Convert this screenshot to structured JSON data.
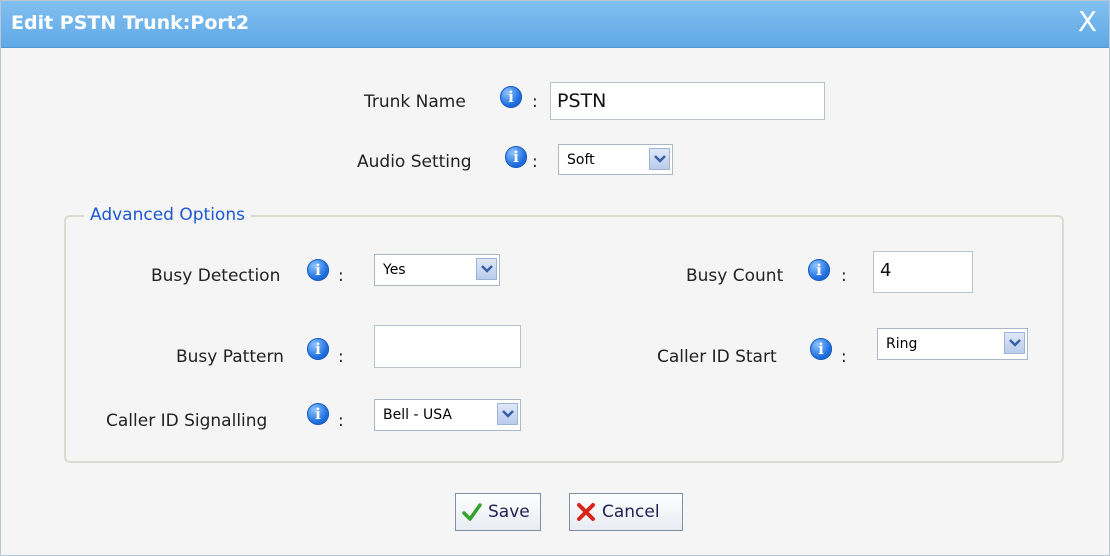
{
  "dialog": {
    "title": "Edit PSTN Trunk:Port2",
    "close_glyph": "X"
  },
  "fields": {
    "trunk_name": {
      "label": "Trunk Name",
      "value": "PSTN"
    },
    "audio_setting": {
      "label": "Audio Setting",
      "value": "Soft"
    }
  },
  "advanced": {
    "legend": "Advanced Options",
    "busy_detection": {
      "label": "Busy Detection",
      "value": "Yes"
    },
    "busy_count": {
      "label": "Busy Count",
      "value": "4"
    },
    "busy_pattern": {
      "label": "Busy Pattern",
      "value": ""
    },
    "caller_id_start": {
      "label": "Caller ID Start",
      "value": "Ring"
    },
    "caller_id_signalling": {
      "label": "Caller ID Signalling",
      "value": "Bell - USA"
    }
  },
  "buttons": {
    "save": "Save",
    "cancel": "Cancel"
  },
  "colors": {
    "titlebar": "#6fb4ec",
    "legend": "#1c58cf",
    "info_icon": "#1f6fe0"
  },
  "icons": [
    "info-icon",
    "close-icon",
    "checkmark-icon",
    "cross-icon",
    "dropdown-arrow-icon"
  ]
}
